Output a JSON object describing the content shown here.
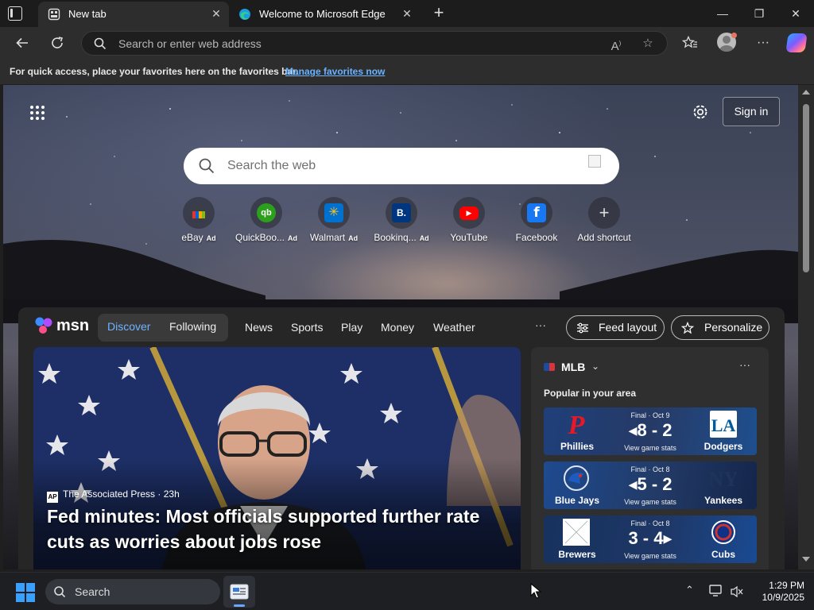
{
  "browser": {
    "tabs": [
      {
        "title": "New tab",
        "close": "✕"
      },
      {
        "title": "Welcome to Microsoft Edge",
        "close": "✕"
      }
    ],
    "new_tab": "+",
    "window_controls": {
      "minimize": "—",
      "maximize": "❐",
      "close": "✕"
    },
    "address": {
      "placeholder": "Search or enter web address",
      "value": ""
    },
    "favorites_bar": {
      "message": "For quick access, place your favorites here on the favorites bar.",
      "link": "Manage favorites now"
    }
  },
  "newtab": {
    "sign_in": "Sign in",
    "search": {
      "placeholder": "Search the web"
    },
    "shortcuts": [
      {
        "label": "eBay",
        "ad": "Ad",
        "color": "#e53238"
      },
      {
        "label": "QuickBoo...",
        "ad": "Ad",
        "color": "#2ca01c",
        "glyph": "qb"
      },
      {
        "label": "Walmart",
        "ad": "Ad",
        "color": "#0071ce",
        "glyph": "✳"
      },
      {
        "label": "Bookinq...",
        "ad": "Ad",
        "color": "#003580",
        "glyph": "B."
      },
      {
        "label": "YouTube",
        "ad": "",
        "color": "#ff0000",
        "glyph": "▶"
      },
      {
        "label": "Facebook",
        "ad": "",
        "color": "#1877f2",
        "glyph": "f"
      },
      {
        "label": "Add shortcut",
        "ad": "",
        "color": "",
        "glyph": "+"
      }
    ]
  },
  "feed": {
    "brand": "msn",
    "segments": [
      "Discover",
      "Following"
    ],
    "nav": [
      "News",
      "Sports",
      "Play",
      "Money",
      "Weather"
    ],
    "more": "···",
    "feed_layout": "Feed layout",
    "personalize": "Personalize",
    "hero": {
      "source": "The Associated Press",
      "source_logo": "AP",
      "age": "23h",
      "headline": "Fed minutes: Most officials supported further rate cuts as worries about jobs rose"
    },
    "sports": {
      "league": "MLB",
      "chevron": "⌄",
      "more": "···",
      "subtitle": "Popular in your area",
      "games": [
        {
          "status": "Final · Oct 9",
          "score": "◂8 - 2",
          "stats": "View game stats",
          "team_left": "Phillies",
          "team_right": "Dodgers",
          "left_color": "#e81828",
          "right_color": "#005a9c"
        },
        {
          "status": "Final · Oct 8",
          "score": "◂5 - 2",
          "stats": "View game stats",
          "team_left": "Blue Jays",
          "team_right": "Yankees",
          "left_color": "#134a8e",
          "right_color": "#0c2340"
        },
        {
          "status": "Final · Oct 8",
          "score": "3 - 4▸",
          "stats": "View game stats",
          "team_left": "Brewers",
          "team_right": "Cubs",
          "left_color": "#12284b",
          "right_color": "#0e3386"
        }
      ]
    }
  },
  "taskbar": {
    "search_label": "Search",
    "time": "1:29 PM",
    "date": "10/9/2025"
  }
}
